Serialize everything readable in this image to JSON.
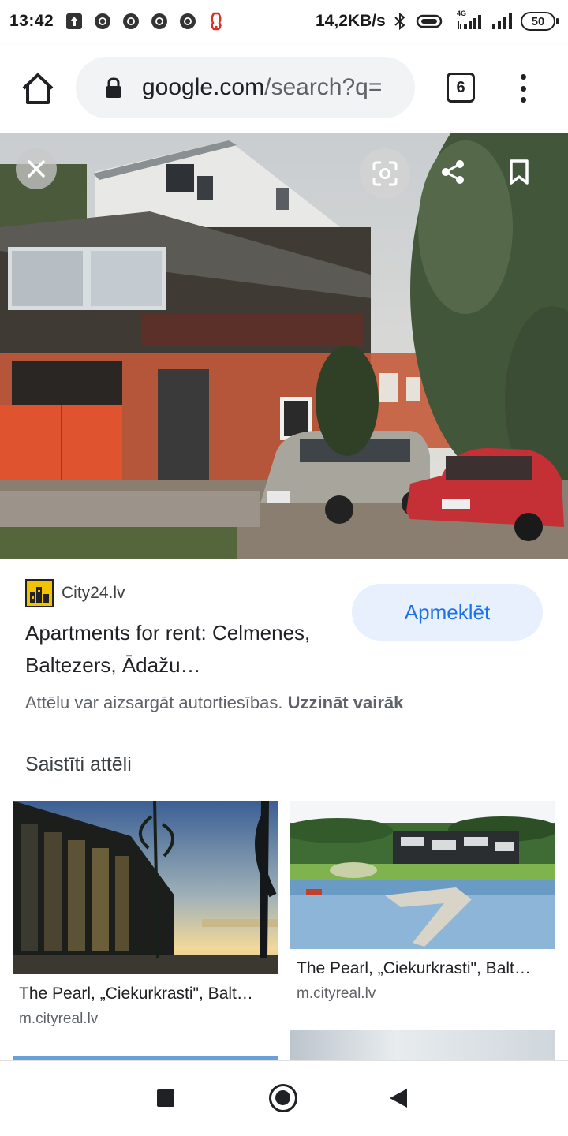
{
  "status_bar": {
    "time": "13:42",
    "net_speed": "14,2KB/s",
    "battery": "50",
    "network_type": "4G",
    "icons": [
      "upload-notification-icon",
      "chrome-notification-icon",
      "chrome-notification-icon",
      "chrome-notification-icon",
      "chrome-notification-icon",
      "alert-notification-icon",
      "bluetooth-icon",
      "vibrate-icon",
      "signal-4g-icon",
      "signal-icon",
      "battery-icon"
    ]
  },
  "browser": {
    "url_host": "google.com",
    "url_path": "/search?q=",
    "tab_count": "6"
  },
  "viewer": {
    "source_name": "City24.lv",
    "visit_label": "Apmeklēt",
    "title": "Apartments for rent: Celmenes, Baltezers, Ādažu…",
    "copyright_text": "Attēlu var aizsargāt autortiesības.",
    "learn_more": "Uzzināt vairāk",
    "accent_color": "#1a73e8"
  },
  "related": {
    "heading": "Saistīti attēli",
    "cards": [
      {
        "title": "The Pearl, „Ciekurkrasti\", Balt…",
        "source": "m.cityreal.lv"
      },
      {
        "title": "The Pearl, „Ciekurkrasti\", Balt…",
        "source": "m.cityreal.lv"
      }
    ]
  }
}
